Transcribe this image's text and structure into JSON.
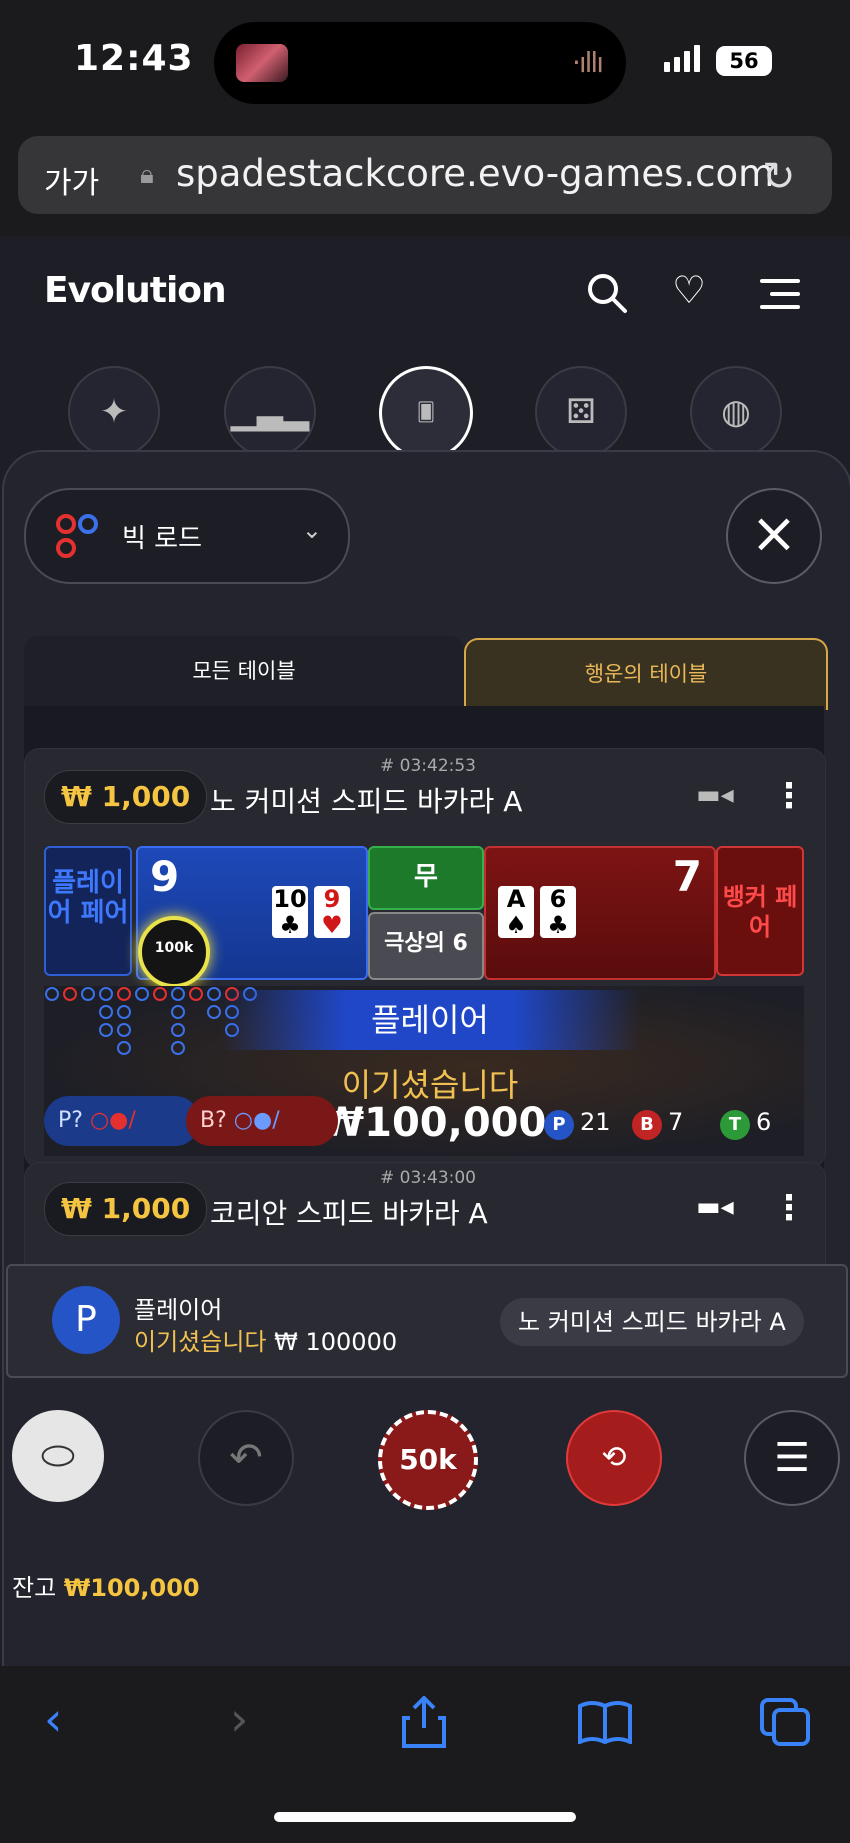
{
  "status_bar": {
    "time": "12:43",
    "battery": "56"
  },
  "browser": {
    "aa_label": "가가",
    "url": "spadestackcore.evo-games.com"
  },
  "app": {
    "logo": "Evolution"
  },
  "filter": {
    "label": "빅 로드"
  },
  "tabs": {
    "all": "모든 테이블",
    "lucky": "행운의 테이블"
  },
  "table1": {
    "timestamp": "# 03:42:53",
    "min_bet": "₩ 1,000",
    "name": "노 커미션 스피드 바카라 A",
    "player_pair_label": "플레이어 페어",
    "player_score": "9",
    "player_cards": [
      {
        "rank": "10",
        "suit": "♣",
        "color": "#000"
      },
      {
        "rank": "9",
        "suit": "♥",
        "color": "#d01818"
      }
    ],
    "chip_label": "100k",
    "tie_label": "무",
    "super6_label": "극상의 6",
    "banker_score": "7",
    "banker_cards": [
      {
        "rank": "A",
        "suit": "♠",
        "color": "#000"
      },
      {
        "rank": "6",
        "suit": "♣",
        "color": "#000"
      }
    ],
    "banker_pair_label": "뱅커 페어",
    "winner_banner": "플레이어",
    "won_label": "이기셨습니다",
    "won_amount": "₩100,000",
    "p_predict": "P?",
    "b_predict": "B?",
    "stats": {
      "p_label": "P",
      "p_count": "21",
      "b_label": "B",
      "b_count": "7",
      "t_label": "T",
      "t_count": "6"
    }
  },
  "table2": {
    "timestamp": "# 03:43:00",
    "min_bet": "₩ 1,000",
    "name": "코리안 스피드 바카라 A"
  },
  "toast": {
    "avatar": "P",
    "title": "플레이어",
    "won": "이기셨습니다",
    "amount": "₩ 100000",
    "table": "노 커미션 스피드 바카라 A"
  },
  "controls": {
    "chip": "50k"
  },
  "balance": {
    "label": "잔고",
    "value": "₩100,000"
  },
  "colors": {
    "accent_gold": "#f5c542",
    "player_blue": "#1f47c8",
    "banker_red": "#7e1414",
    "tie_green": "#1d7a2a"
  }
}
